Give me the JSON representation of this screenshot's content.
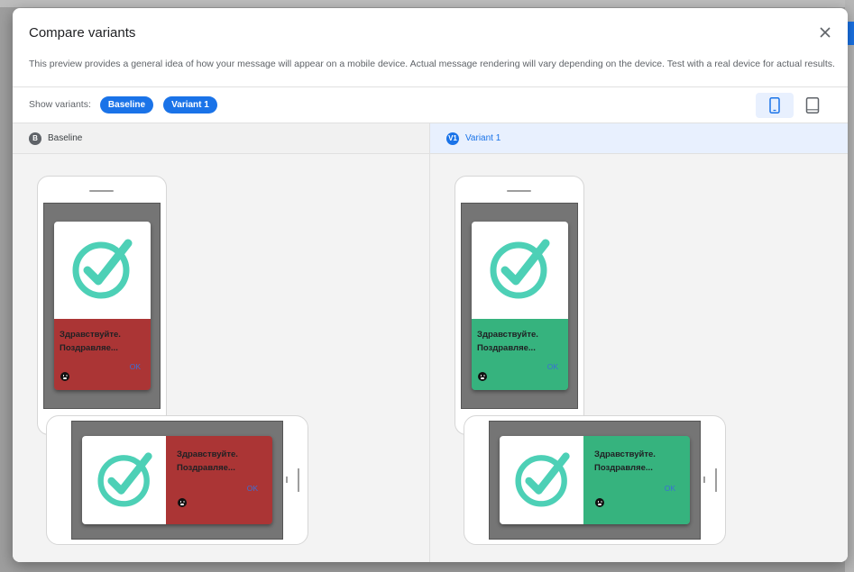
{
  "dialog": {
    "title": "Compare variants",
    "description": "This preview provides a general idea of how your message will appear on a mobile device. Actual message rendering will vary depending on the device. Test with a real device for actual results."
  },
  "toolbar": {
    "show_variants_label": "Show variants:",
    "chips": [
      "Baseline",
      "Variant 1"
    ],
    "device_options": [
      {
        "icon": "phone-icon",
        "active": true
      },
      {
        "icon": "tablet-icon",
        "active": false
      }
    ]
  },
  "columns": [
    {
      "badge": "B",
      "name": "Baseline",
      "message": {
        "line1": "Здравствуйте.",
        "line2": "Поздравляе...",
        "button": "OK",
        "body_color": "#ab3535"
      }
    },
    {
      "badge": "V1",
      "name": "Variant 1",
      "message": {
        "line1": "Здравствуйте.",
        "line2": "Поздравляе...",
        "button": "OK",
        "body_color": "#36b37e"
      }
    }
  ],
  "colors": {
    "accent": "#1a73e8",
    "check": "#4dd0b6"
  }
}
